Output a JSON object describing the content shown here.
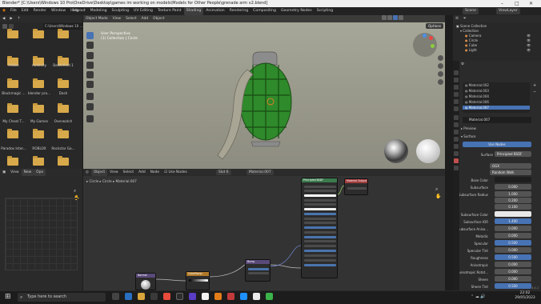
{
  "titlebar": {
    "text": "Blender* [C:\\Users\\Windows 10 Pro\\OneDrive\\Desktop\\games im working on models\\Models for Other People\\grenade arm v2.blend]"
  },
  "menu": {
    "items": [
      "File",
      "Edit",
      "Render",
      "Window",
      "Help"
    ],
    "workspaces": [
      "Layout",
      "Modeling",
      "Sculpting",
      "UV Editing",
      "Texture Paint",
      "Shading",
      "Animation",
      "Rendering",
      "Compositing",
      "Geometry Nodes",
      "Scripting"
    ],
    "active_workspace": "Shading",
    "scene": "Scene",
    "view_layer": "ViewLayer"
  },
  "filebrowser": {
    "path": "C:\\Users\\Windows 10 ...",
    "folders": [
      "Adobe",
      "Audacity",
      "Battlefield 1",
      "Blackmagic ...",
      "blender pro...",
      "Dash",
      "My Cheat T...",
      "My Games",
      "Overwatch",
      "Paradox Inter...",
      "ROBLOX",
      "Rockstar Ga...",
      "",
      "",
      ""
    ],
    "view_label": "View",
    "new_label": "New",
    "open_label": "Ope"
  },
  "viewport": {
    "header": {
      "mode": "Object Mode",
      "view": "View",
      "select": "Select",
      "add": "Add",
      "object": "Object",
      "options": "Options"
    },
    "overlay_line1": "User Perspective",
    "overlay_line2": "(1) Collection | Circle"
  },
  "nodeeditor": {
    "header": {
      "editor": "Object",
      "view": "View",
      "select": "Select",
      "add": "Add",
      "node": "Node",
      "use_nodes": "Use Nodes",
      "slot": "Slot 6",
      "material": "Material.007"
    },
    "breadcrumb": [
      "Circle",
      "Circle",
      "Material.007"
    ],
    "nodes": [
      {
        "title": "Principled BSDF",
        "color": "#3c7a4e"
      },
      {
        "title": "Material Output",
        "color": "#a33d3d"
      },
      {
        "title": "Bump",
        "color": "#5a4a7a"
      },
      {
        "title": "ColorRamp",
        "color": "#b07a2a"
      },
      {
        "title": "Normal",
        "color": "#5a4a7a"
      }
    ]
  },
  "outliner": {
    "title": "Scene Collection",
    "items": [
      {
        "name": "Collection",
        "depth": 1,
        "color": "#bbbbbb"
      },
      {
        "name": "Camera",
        "depth": 2,
        "color": "#d88c4a"
      },
      {
        "name": "Circle",
        "depth": 2,
        "color": "#d88c4a"
      },
      {
        "name": "Cube",
        "depth": 2,
        "color": "#d88c4a"
      },
      {
        "name": "Light",
        "depth": 2,
        "color": "#d88c4a"
      }
    ]
  },
  "properties": {
    "slots": [
      "Material.002",
      "Material.003",
      "Material.004",
      "Material.006",
      "Material.007"
    ],
    "active_slot": "Material.007",
    "material_name": "Material.007",
    "sections": {
      "preview": "Preview",
      "surface": "Surface"
    },
    "use_nodes": "Use Nodes",
    "surface_label": "Surface",
    "surface_value": "Principled BSDF",
    "distribution": "GGX",
    "subsurface_method": "Random Walk",
    "rows": [
      {
        "label": "Base Color",
        "value": "",
        "type": "color-dark"
      },
      {
        "label": "Subsurface",
        "value": "0.000",
        "type": "num"
      },
      {
        "label": "Subsurface Radius",
        "value": "1.000",
        "type": "num"
      },
      {
        "label": "",
        "value": "0.200",
        "type": "num"
      },
      {
        "label": "",
        "value": "0.100",
        "type": "num"
      },
      {
        "label": "Subsurface Color",
        "value": "",
        "type": "color-white"
      },
      {
        "label": "Subsurface IOR",
        "value": "1.400",
        "type": "blue"
      },
      {
        "label": "Subsurface Aniso...",
        "value": "0.000",
        "type": "num"
      },
      {
        "label": "Metallic",
        "value": "0.000",
        "type": "num"
      },
      {
        "label": "Specular",
        "value": "0.500",
        "type": "blue"
      },
      {
        "label": "Specular Tint",
        "value": "0.000",
        "type": "num"
      },
      {
        "label": "Roughness",
        "value": "0.500",
        "type": "blue"
      },
      {
        "label": "Anisotropic",
        "value": "0.000",
        "type": "num"
      },
      {
        "label": "Anisotropic Rotat...",
        "value": "0.000",
        "type": "num"
      },
      {
        "label": "Sheen",
        "value": "0.000",
        "type": "num"
      },
      {
        "label": "Sheen Tint",
        "value": "0.500",
        "type": "blue"
      }
    ]
  },
  "taskbar": {
    "search_placeholder": "Type here to search",
    "time": "22:02",
    "date": "29/05/2023",
    "version": "3.4.1"
  }
}
